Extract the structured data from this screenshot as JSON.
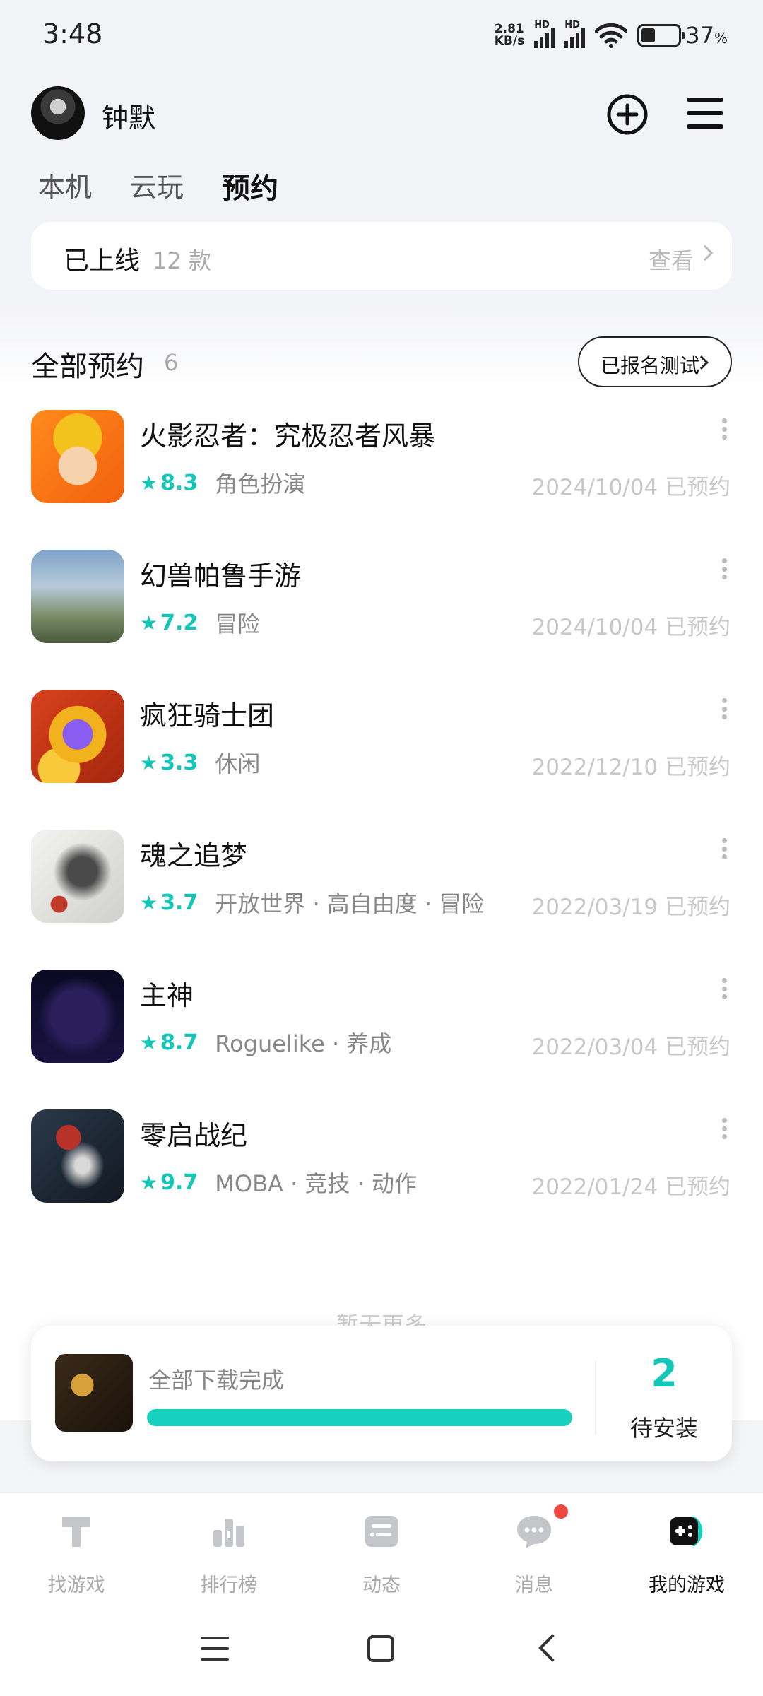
{
  "status_bar": {
    "time": "3:48",
    "net_speed_value": "2.81",
    "net_speed_unit": "KB/s",
    "hd1": "HD",
    "hd2": "HD",
    "battery_percent": "37",
    "battery_unit": "%"
  },
  "header": {
    "user_name": "钟默"
  },
  "tabs": [
    {
      "label": "本机"
    },
    {
      "label": "云玩"
    },
    {
      "label": "预约"
    }
  ],
  "online": {
    "label": "已上线",
    "count": "12 款",
    "view_label": "查看"
  },
  "section": {
    "title": "全部预约",
    "count": "6",
    "test_button_label": "已报名测试"
  },
  "games": [
    {
      "name": "火影忍者：究极忍者风暴",
      "rating": "8.3",
      "tags": "角色扮演",
      "date": "2024/10/04 已预约"
    },
    {
      "name": "幻兽帕鲁手游",
      "rating": "7.2",
      "tags": "冒险",
      "date": "2024/10/04 已预约"
    },
    {
      "name": "疯狂骑士团",
      "rating": "3.3",
      "tags": "休闲",
      "date": "2022/12/10 已预约"
    },
    {
      "name": "魂之追梦",
      "rating": "3.7",
      "tags": "开放世界 · 高自由度 · 冒险",
      "date": "2022/03/19 已预约"
    },
    {
      "name": "主神",
      "rating": "8.7",
      "tags": "Roguelike · 养成",
      "date": "2022/03/04 已预约"
    },
    {
      "name": "零启战纪",
      "rating": "9.7",
      "tags": "MOBA · 竞技 · 动作",
      "date": "2022/01/24 已预约"
    }
  ],
  "no_more": "暂无更多",
  "download": {
    "status": "全部下载完成",
    "progress_percent": 100,
    "pending_count": "2",
    "pending_label": "待安装"
  },
  "bottom_nav": [
    {
      "label": "找游戏",
      "icon": "find-games-icon"
    },
    {
      "label": "排行榜",
      "icon": "ranking-icon"
    },
    {
      "label": "动态",
      "icon": "feed-icon"
    },
    {
      "label": "消息",
      "icon": "message-icon"
    },
    {
      "label": "我的游戏",
      "icon": "my-games-icon"
    }
  ],
  "colors": {
    "accent": "#12c7b7",
    "tab_underline": "#1fd1c1",
    "badge": "#f0463f"
  }
}
